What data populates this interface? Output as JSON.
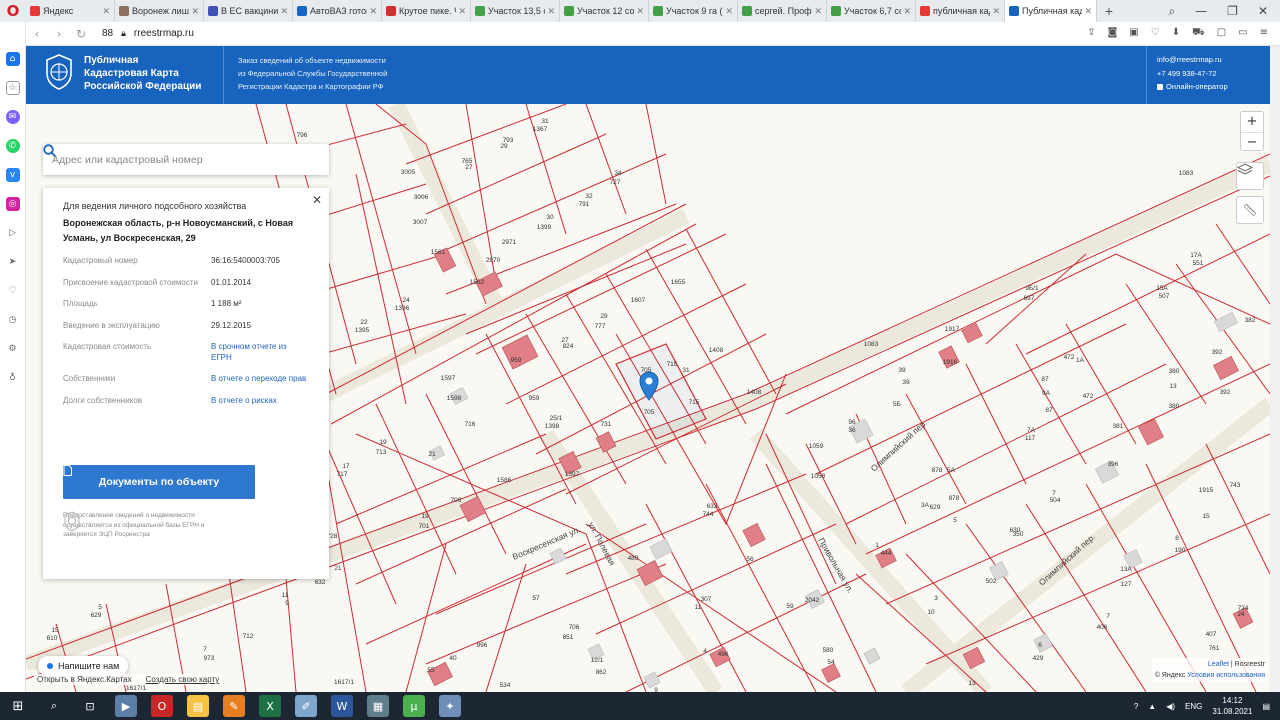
{
  "browser": {
    "tabs": [
      {
        "title": "Яндекс",
        "color": "#e53935"
      },
      {
        "title": "Воронеж лишн",
        "color": "#8d6e63"
      },
      {
        "title": "В ЕС вакцинир",
        "color": "#3f51b5"
      },
      {
        "title": "АвтоВАЗ готов",
        "color": "#1565c0"
      },
      {
        "title": "Крутое пике. Ч",
        "color": "#d32f2f"
      },
      {
        "title": "Участок 13,5 сс",
        "color": "#43a047"
      },
      {
        "title": "Участок 12 сот",
        "color": "#43a047"
      },
      {
        "title": "Участок 9 га (С",
        "color": "#43a047"
      },
      {
        "title": "сергей. Профи",
        "color": "#43a047"
      },
      {
        "title": "Участок 6,7 сот",
        "color": "#43a047"
      },
      {
        "title": "публичная када",
        "color": "#e53935"
      }
    ],
    "active_tab": "Публичная када",
    "url": "rreestrmap.ru",
    "speed_dial_count": "88"
  },
  "header": {
    "brand_line1": "Публичная",
    "brand_line2": "Кадастровая Карта",
    "brand_line3": "Российской Федерации",
    "desc_line1": "Заказ сведений об объекте недвижимости",
    "desc_line2": "из Федеральной Службы Государственной",
    "desc_line3": "Регистрации Кадастра и Картографии РФ",
    "email": "info@rreestrmap.ru",
    "phone": "+7 499 938-47-72",
    "operator": "Онлайн-оператор"
  },
  "search": {
    "placeholder": "Адрес или кадастровый номер"
  },
  "panel": {
    "purpose": "Для ведения личного подсобного хозяйства",
    "address": "Воронежская область, р-н Новоусманский, с Новая Усмань, ул Воскресенская, 29",
    "rows": [
      {
        "key": "Кадастровый номер",
        "value": "36:16:5400003:705",
        "link": false
      },
      {
        "key": "Присвоение кадастровой стоимости",
        "value": "01.01.2014",
        "link": false
      },
      {
        "key": "Площадь",
        "value": "1 188 м²",
        "link": false
      },
      {
        "key": "Введение в эксплуатацию",
        "value": "29.12.2015",
        "link": false
      },
      {
        "key": "Кадастровая стоимость",
        "value": "В срочном отчете из ЕГРН",
        "link": true
      },
      {
        "key": "Собственники",
        "value": "В отчете о переходе прав",
        "link": true
      },
      {
        "key": "Долги собственников",
        "value": "В отчете о рисках",
        "link": true
      }
    ],
    "button": "Документы по объекту",
    "footnote": "Предоставление сведений о недвижимости осуществляется из официальной базы ЕГРН и заверяется ЭЦП Росреестра"
  },
  "map": {
    "zoom_in": "+",
    "zoom_out": "−",
    "chat": "Напишите нам",
    "yandex_open": "Открыть в Яндекс.Картах",
    "create_map": "Создать свою карту",
    "attr_leaflet": "Leaflet",
    "attr_rosreestr": "Rosreestr",
    "attr_yandex": "© Яндекс",
    "attr_terms": "Условия использования",
    "streets": [
      "Воскресенская ул.",
      "ул. Полевая",
      "Олимпийский пер.",
      "Олимпийский пер.",
      "Привольная ул."
    ],
    "labels": [
      "705",
      "705",
      "715",
      "715",
      "31",
      "1408",
      "1607",
      "1655",
      "1408",
      "29",
      "777",
      "27",
      "824",
      "959",
      "959",
      "25/1",
      "1398",
      "731",
      "1397",
      "1597",
      "1598",
      "716",
      "713",
      "19",
      "21",
      "17",
      "717",
      "1586",
      "706",
      "19",
      "701",
      "1396",
      "24",
      "1395",
      "22",
      "981",
      "23",
      "1399",
      "30",
      "791",
      "32",
      "727",
      "34",
      "1367",
      "31",
      "29",
      "793",
      "27",
      "765",
      "3005",
      "3006",
      "3007",
      "1561",
      "1562",
      "2970",
      "2971",
      "1083",
      "1083",
      "9Б/1",
      "697",
      "1917",
      "1916",
      "39",
      "39",
      "5Б",
      "1059",
      "1058",
      "36",
      "96",
      "1А",
      "472",
      "472",
      "87",
      "9А",
      "87",
      "7А",
      "117",
      "7",
      "504",
      "380",
      "13",
      "380",
      "381",
      "396",
      "15А",
      "507",
      "17А",
      "551",
      "392",
      "392",
      "382",
      "629",
      "3А",
      "878",
      "5А",
      "878",
      "5",
      "350",
      "630",
      "1",
      "444",
      "3",
      "10",
      "502",
      "8",
      "190",
      "13А",
      "127",
      "1915",
      "15",
      "743",
      "633",
      "744",
      "56",
      "489",
      "307",
      "11",
      "59",
      "2042",
      "706",
      "851",
      "57",
      "996",
      "12/1",
      "862",
      "40",
      "55",
      "534",
      "9",
      "580",
      "54",
      "4",
      "496",
      "6",
      "429",
      "7",
      "406",
      "407",
      "761",
      "24",
      "724",
      "13",
      "632",
      "632",
      "11",
      "9",
      "712",
      "7",
      "973",
      "5",
      "629",
      "15",
      "610",
      "21",
      "728",
      "1617/1",
      "1617/1",
      "796"
    ]
  },
  "taskbar": {
    "lang": "ENG",
    "time": "14:12",
    "date": "31.08.2021",
    "apps": [
      {
        "name": "search-app",
        "color": "#1c2733",
        "glyph": "⌕"
      },
      {
        "name": "taskview",
        "color": "#1c2733",
        "glyph": "⊡"
      },
      {
        "name": "media-player",
        "color": "#5b7fa6",
        "glyph": "▶"
      },
      {
        "name": "opera",
        "color": "#c62828",
        "glyph": "O"
      },
      {
        "name": "explorer",
        "color": "#f6c244",
        "glyph": "▤"
      },
      {
        "name": "ms-paint",
        "color": "#e67e22",
        "glyph": "✎"
      },
      {
        "name": "excel",
        "color": "#1e7145",
        "glyph": "X"
      },
      {
        "name": "onenote",
        "color": "#7fa7cc",
        "glyph": "✐"
      },
      {
        "name": "word",
        "color": "#2b579a",
        "glyph": "W"
      },
      {
        "name": "calculator",
        "color": "#607d8b",
        "glyph": "▦"
      },
      {
        "name": "utorrent",
        "color": "#4caf50",
        "glyph": "µ"
      },
      {
        "name": "paint-app",
        "color": "#6d8fb8",
        "glyph": "✦"
      }
    ]
  },
  "colors": {
    "brand_blue": "#1763bd",
    "button_blue": "#2f78cf",
    "parcel_red": "#d62b35",
    "link_blue": "#1e63c0"
  }
}
